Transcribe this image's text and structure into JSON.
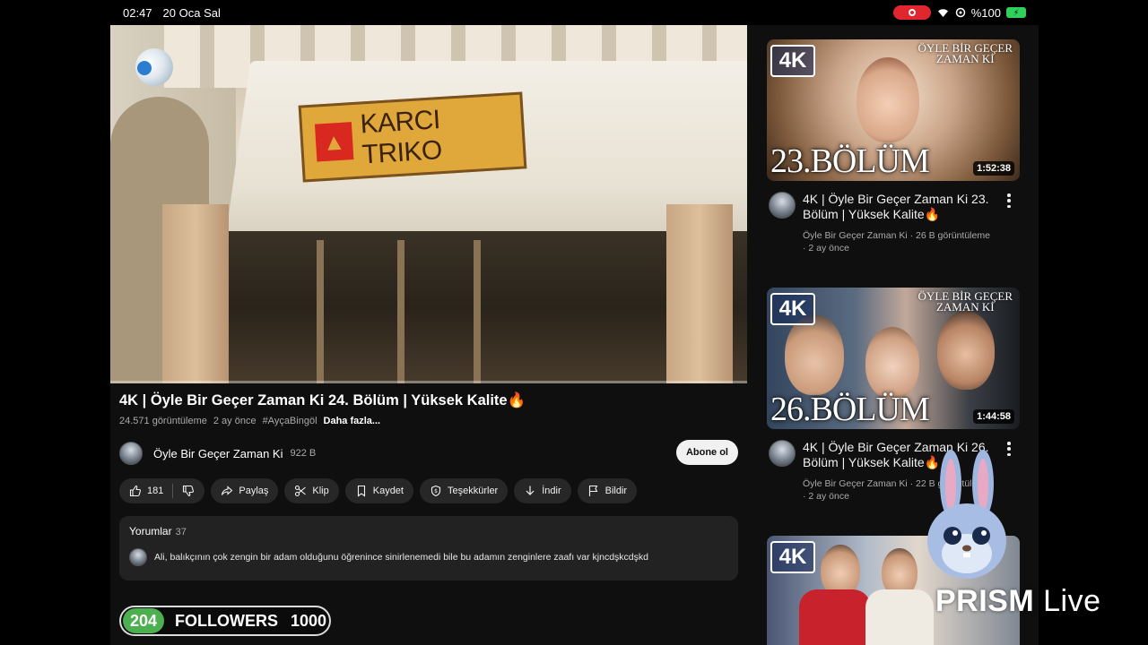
{
  "status_bar": {
    "time": "02:47",
    "date": "20 Oca Sal",
    "battery": "%100"
  },
  "video": {
    "sign_text": "KARCI TRIKO",
    "title": "4K | Öyle Bir Geçer Zaman Ki 24. Bölüm | Yüksek Kalite🔥",
    "views": "24.571 görüntüleme",
    "age": "2 ay önce",
    "hashtag": "#AyçaBingöl",
    "more": "Daha fazla..."
  },
  "channel": {
    "name": "Öyle Bir Geçer Zaman Ki",
    "subscribers": "922 B",
    "subscribe_label": "Abone ol"
  },
  "actions": {
    "likes": "181",
    "share": "Paylaş",
    "clip": "Klip",
    "save": "Kaydet",
    "thanks": "Teşekkürler",
    "download": "İndir",
    "report": "Bildir"
  },
  "comments": {
    "header": "Yorumlar",
    "count": "37",
    "first_comment": "Ali, balıkçının çok zengin bir adam olduğunu öğrenince sinirlenemedi bile bu adamın zenginlere zaafı var kjncdşkcdşkd"
  },
  "sidebar": {
    "videos": [
      {
        "badge": "4K",
        "show_line1": "ÖYLE BİR GEÇER",
        "show_line2": "ZAMAN Kİ",
        "episode_label": "23.BÖLÜM",
        "duration": "1:52:38",
        "title": "4K | Öyle Bir Geçer Zaman Ki 23. Bölüm | Yüksek Kalite🔥",
        "meta": "Öyle Bir Geçer Zaman Ki · 26 B görüntüleme · 2 ay önce"
      },
      {
        "badge": "4K",
        "show_line1": "ÖYLE BİR GEÇER",
        "show_line2": "ZAMAN Kİ",
        "episode_label": "26.BÖLÜM",
        "duration": "1:44:58",
        "title": "4K | Öyle Bir Geçer Zaman Ki 26. Bölüm | Yüksek Kalite🔥",
        "meta": "Öyle Bir Geçer Zaman Ki · 22 B görüntüleme · 2 ay önce"
      },
      {
        "badge": "4K"
      }
    ]
  },
  "overlay": {
    "followers_count": "204",
    "followers_label": "FOLLOWERS",
    "followers_goal": "1000",
    "brand_bold": "PRISM",
    "brand_light": " Live"
  },
  "colors": {
    "background": "#0f0f0f",
    "pill": "#272727",
    "accent_red": "#ff0000",
    "followers_green": "#4caf50"
  }
}
